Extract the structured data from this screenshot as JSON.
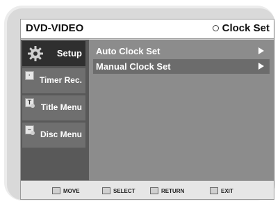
{
  "header": {
    "title": "DVD-VIDEO",
    "section": "Clock Set"
  },
  "sidebar": {
    "items": [
      {
        "label": "Setup",
        "icon": "gear-icon",
        "active": true
      },
      {
        "label": "Timer Rec.",
        "icon": "timer-icon",
        "active": false
      },
      {
        "label": "Title Menu",
        "icon": "title-icon",
        "active": false
      },
      {
        "label": "Disc Menu",
        "icon": "disc-icon",
        "active": false
      }
    ]
  },
  "menu": {
    "items": [
      {
        "label": "Auto Clock Set",
        "selected": false
      },
      {
        "label": "Manual Clock Set",
        "selected": true
      }
    ]
  },
  "footer": {
    "move": "MOVE",
    "select": "SELECT",
    "return": "RETURN",
    "exit": "EXIT"
  },
  "title_icon_letter": "T"
}
